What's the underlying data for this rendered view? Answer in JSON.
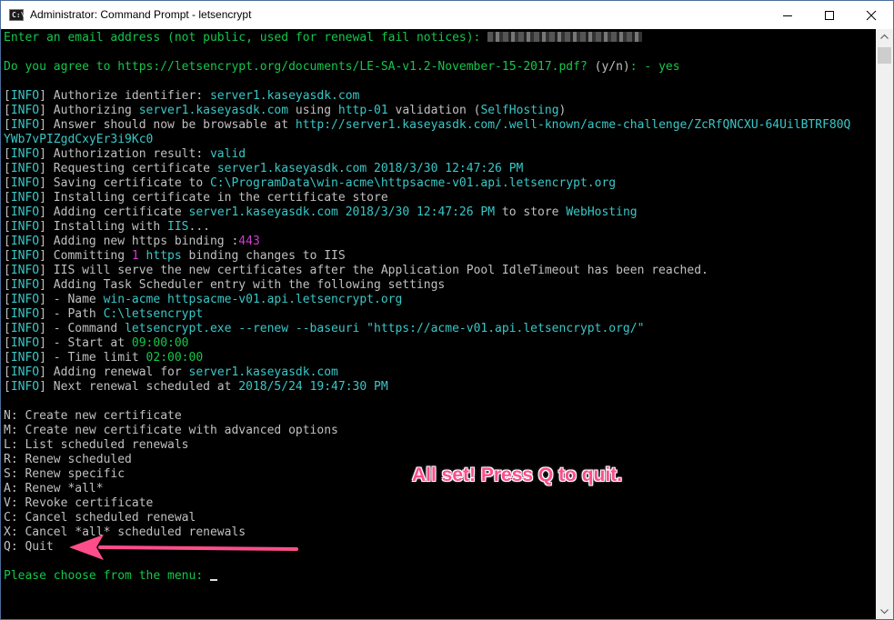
{
  "window": {
    "title": "Administrator: Command Prompt - letsencrypt",
    "icon": "cmd-icon",
    "icon_text": "C:\\"
  },
  "colors": {
    "green": "#13c74a",
    "cyan": "#3ac7c7",
    "magenta": "#d23ad2",
    "gray": "#c0c0c0",
    "annotation": "#ff4d8c"
  },
  "console": [
    [
      {
        "t": "Enter an email address (not public, used for renewal fail notices): ",
        "c": "g"
      },
      {
        "redacted": true
      }
    ],
    [],
    [
      {
        "t": "Do you agree to https://letsencrypt.org/documents/LE-SA-v1.2-November-15-2017.pdf? ",
        "c": "g"
      },
      {
        "t": "(y/n)",
        "c": "w"
      },
      {
        "t": ": - yes",
        "c": "g"
      }
    ],
    [],
    [
      {
        "t": "[",
        "c": "w"
      },
      {
        "t": "INFO",
        "c": "c"
      },
      {
        "t": "] Authorize identifier: ",
        "c": "w"
      },
      {
        "t": "server1.kaseyasdk.com",
        "c": "c"
      }
    ],
    [
      {
        "t": "[",
        "c": "w"
      },
      {
        "t": "INFO",
        "c": "c"
      },
      {
        "t": "] Authorizing ",
        "c": "w"
      },
      {
        "t": "server1.kaseyasdk.com",
        "c": "c"
      },
      {
        "t": " using ",
        "c": "w"
      },
      {
        "t": "http-01",
        "c": "c"
      },
      {
        "t": " validation (",
        "c": "w"
      },
      {
        "t": "SelfHosting",
        "c": "c"
      },
      {
        "t": ")",
        "c": "w"
      }
    ],
    [
      {
        "t": "[",
        "c": "w"
      },
      {
        "t": "INFO",
        "c": "c"
      },
      {
        "t": "] Answer should now be browsable at ",
        "c": "w"
      },
      {
        "t": "http://server1.kaseyasdk.com/.well-known/acme-challenge/ZcRfQNCXU-64UilBTRF80Q",
        "c": "c"
      }
    ],
    [
      {
        "t": "YWb7vPIZgdCxyEr3i9Kc0",
        "c": "c"
      }
    ],
    [
      {
        "t": "[",
        "c": "w"
      },
      {
        "t": "INFO",
        "c": "c"
      },
      {
        "t": "] Authorization result: ",
        "c": "w"
      },
      {
        "t": "valid",
        "c": "c"
      }
    ],
    [
      {
        "t": "[",
        "c": "w"
      },
      {
        "t": "INFO",
        "c": "c"
      },
      {
        "t": "] Requesting certificate ",
        "c": "w"
      },
      {
        "t": "server1.kaseyasdk.com 2018/3/30 12:47:26 PM",
        "c": "c"
      }
    ],
    [
      {
        "t": "[",
        "c": "w"
      },
      {
        "t": "INFO",
        "c": "c"
      },
      {
        "t": "] Saving certificate to ",
        "c": "w"
      },
      {
        "t": "C:\\ProgramData\\win-acme\\httpsacme-v01.api.letsencrypt.org",
        "c": "c"
      }
    ],
    [
      {
        "t": "[",
        "c": "w"
      },
      {
        "t": "INFO",
        "c": "c"
      },
      {
        "t": "] Installing certificate in the certificate store",
        "c": "w"
      }
    ],
    [
      {
        "t": "[",
        "c": "w"
      },
      {
        "t": "INFO",
        "c": "c"
      },
      {
        "t": "] Adding certificate ",
        "c": "w"
      },
      {
        "t": "server1.kaseyasdk.com 2018/3/30 12:47:26 PM",
        "c": "c"
      },
      {
        "t": " to store ",
        "c": "w"
      },
      {
        "t": "WebHosting",
        "c": "c"
      }
    ],
    [
      {
        "t": "[",
        "c": "w"
      },
      {
        "t": "INFO",
        "c": "c"
      },
      {
        "t": "] Installing with ",
        "c": "w"
      },
      {
        "t": "IIS",
        "c": "c"
      },
      {
        "t": "...",
        "c": "w"
      }
    ],
    [
      {
        "t": "[",
        "c": "w"
      },
      {
        "t": "INFO",
        "c": "c"
      },
      {
        "t": "] Adding new https binding :",
        "c": "w"
      },
      {
        "t": "443",
        "c": "m"
      }
    ],
    [
      {
        "t": "[",
        "c": "w"
      },
      {
        "t": "INFO",
        "c": "c"
      },
      {
        "t": "] Committing ",
        "c": "w"
      },
      {
        "t": "1",
        "c": "m"
      },
      {
        "t": " https",
        "c": "c"
      },
      {
        "t": " binding changes to IIS",
        "c": "w"
      }
    ],
    [
      {
        "t": "[",
        "c": "w"
      },
      {
        "t": "INFO",
        "c": "c"
      },
      {
        "t": "] IIS will serve the new certificates after the Application Pool IdleTimeout has been reached.",
        "c": "w"
      }
    ],
    [
      {
        "t": "[",
        "c": "w"
      },
      {
        "t": "INFO",
        "c": "c"
      },
      {
        "t": "] Adding Task Scheduler entry with the following settings",
        "c": "w"
      }
    ],
    [
      {
        "t": "[",
        "c": "w"
      },
      {
        "t": "INFO",
        "c": "c"
      },
      {
        "t": "] - Name ",
        "c": "w"
      },
      {
        "t": "win-acme httpsacme-v01.api.letsencrypt.org",
        "c": "c"
      }
    ],
    [
      {
        "t": "[",
        "c": "w"
      },
      {
        "t": "INFO",
        "c": "c"
      },
      {
        "t": "] - Path ",
        "c": "w"
      },
      {
        "t": "C:\\letsencrypt",
        "c": "c"
      }
    ],
    [
      {
        "t": "[",
        "c": "w"
      },
      {
        "t": "INFO",
        "c": "c"
      },
      {
        "t": "] - Command ",
        "c": "w"
      },
      {
        "t": "letsencrypt.exe --renew --baseuri \"https://acme-v01.api.letsencrypt.org/\"",
        "c": "c"
      }
    ],
    [
      {
        "t": "[",
        "c": "w"
      },
      {
        "t": "INFO",
        "c": "c"
      },
      {
        "t": "] - Start at ",
        "c": "w"
      },
      {
        "t": "09:00:00",
        "c": "g"
      }
    ],
    [
      {
        "t": "[",
        "c": "w"
      },
      {
        "t": "INFO",
        "c": "c"
      },
      {
        "t": "] - Time limit ",
        "c": "w"
      },
      {
        "t": "02:00:00",
        "c": "g"
      }
    ],
    [
      {
        "t": "[",
        "c": "w"
      },
      {
        "t": "INFO",
        "c": "c"
      },
      {
        "t": "] Adding renewal for ",
        "c": "w"
      },
      {
        "t": "server1.kaseyasdk.com",
        "c": "c"
      }
    ],
    [
      {
        "t": "[",
        "c": "w"
      },
      {
        "t": "INFO",
        "c": "c"
      },
      {
        "t": "] Next renewal scheduled at ",
        "c": "w"
      },
      {
        "t": "2018/5/24 19:47:30 PM",
        "c": "c"
      }
    ],
    [],
    [
      {
        "t": "N",
        "c": "w"
      },
      {
        "t": ": Create new certificate",
        "c": "w"
      }
    ],
    [
      {
        "t": "M",
        "c": "w"
      },
      {
        "t": ": Create new certificate with advanced options",
        "c": "w"
      }
    ],
    [
      {
        "t": "L",
        "c": "w"
      },
      {
        "t": ": List scheduled renewals",
        "c": "w"
      }
    ],
    [
      {
        "t": "R",
        "c": "w"
      },
      {
        "t": ": Renew scheduled",
        "c": "w"
      }
    ],
    [
      {
        "t": "S",
        "c": "w"
      },
      {
        "t": ": Renew specific",
        "c": "w"
      }
    ],
    [
      {
        "t": "A",
        "c": "w"
      },
      {
        "t": ": Renew *all*",
        "c": "w"
      }
    ],
    [
      {
        "t": "V",
        "c": "w"
      },
      {
        "t": ": Revoke certificate",
        "c": "w"
      }
    ],
    [
      {
        "t": "C",
        "c": "w"
      },
      {
        "t": ": Cancel scheduled renewal",
        "c": "w"
      }
    ],
    [
      {
        "t": "X",
        "c": "w"
      },
      {
        "t": ": Cancel *all* scheduled renewals",
        "c": "w"
      }
    ],
    [
      {
        "t": "Q",
        "c": "w"
      },
      {
        "t": ": Quit",
        "c": "w"
      }
    ],
    [],
    [
      {
        "t": "Please choose from the menu: ",
        "c": "g"
      },
      {
        "cursor": true
      }
    ]
  ],
  "annotation": {
    "text": "All set! Press Q to quit.",
    "arrow_icon": "arrow-left-icon"
  }
}
